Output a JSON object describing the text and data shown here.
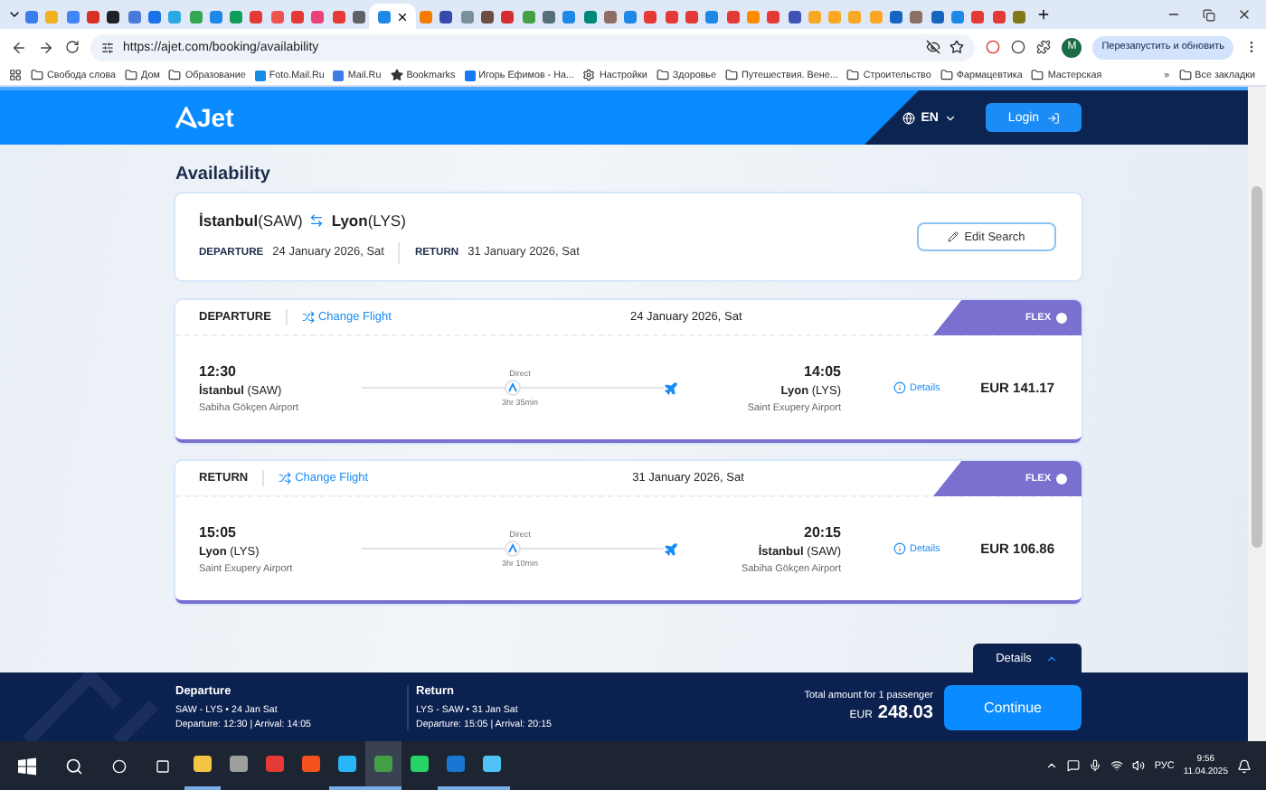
{
  "browser": {
    "tabs": [
      {
        "color": "#3b7ded",
        "selected": false
      },
      {
        "color": "#f2b01e",
        "selected": false
      },
      {
        "color": "#4285f4",
        "selected": false
      },
      {
        "color": "#d93025",
        "selected": false
      },
      {
        "color": "#202124",
        "selected": false
      },
      {
        "color": "#4a7bd8",
        "selected": false
      },
      {
        "color": "#1a73e8",
        "selected": false
      },
      {
        "color": "#29a9e1",
        "selected": false
      },
      {
        "color": "#34a853",
        "selected": false
      },
      {
        "color": "#1e88e5",
        "selected": false
      },
      {
        "color": "#0f9d58",
        "selected": false
      },
      {
        "color": "#e53935",
        "selected": false
      },
      {
        "color": "#ef5350",
        "selected": false
      },
      {
        "color": "#e53935",
        "selected": false
      },
      {
        "color": "#ec407a",
        "selected": false
      },
      {
        "color": "#e53935",
        "selected": false
      },
      {
        "color": "#5f6368",
        "selected": false
      },
      {
        "color": "#1e88e5",
        "selected": true
      },
      {
        "color": "#f57c00",
        "selected": false
      },
      {
        "color": "#3949ab",
        "selected": false
      },
      {
        "color": "#78909c",
        "selected": false
      },
      {
        "color": "#6d4c41",
        "selected": false
      },
      {
        "color": "#d32f2f",
        "selected": false
      },
      {
        "color": "#43a047",
        "selected": false
      },
      {
        "color": "#546e7a",
        "selected": false
      },
      {
        "color": "#1e88e5",
        "selected": false
      },
      {
        "color": "#00897b",
        "selected": false
      },
      {
        "color": "#8d6e63",
        "selected": false
      },
      {
        "color": "#1e88e5",
        "selected": false
      },
      {
        "color": "#e53935",
        "selected": false
      },
      {
        "color": "#e53935",
        "selected": false
      },
      {
        "color": "#e53935",
        "selected": false
      },
      {
        "color": "#1e88e5",
        "selected": false
      },
      {
        "color": "#e53935",
        "selected": false
      },
      {
        "color": "#fb8c00",
        "selected": false
      },
      {
        "color": "#e53935",
        "selected": false
      },
      {
        "color": "#3f51b5",
        "selected": false
      },
      {
        "color": "#f9a825",
        "selected": false
      },
      {
        "color": "#f9a825",
        "selected": false
      },
      {
        "color": "#f9a825",
        "selected": false
      },
      {
        "color": "#f9a825",
        "selected": false
      },
      {
        "color": "#1565c0",
        "selected": false
      },
      {
        "color": "#8d6e63",
        "selected": false
      },
      {
        "color": "#1565c0",
        "selected": false
      },
      {
        "color": "#1e88e5",
        "selected": false
      },
      {
        "color": "#e53935",
        "selected": false
      },
      {
        "color": "#e53935",
        "selected": false
      },
      {
        "color": "#827717",
        "selected": false
      }
    ],
    "url": "https://ajet.com/booking/availability",
    "profile_initial": "M",
    "restart_button": "Перезапустить и обновить",
    "bookmarks": [
      {
        "kind": "folder",
        "label": "Свобода слова"
      },
      {
        "kind": "folder",
        "label": "Дом"
      },
      {
        "kind": "folder",
        "label": "Образование"
      },
      {
        "kind": "site",
        "label": "Foto.Mail.Ru",
        "color": "#168de2"
      },
      {
        "kind": "site",
        "label": "Mail.Ru",
        "color": "#3d7de8"
      },
      {
        "kind": "star",
        "label": "Bookmarks"
      },
      {
        "kind": "site",
        "label": "Игорь Ефимов - На...",
        "color": "#1877f2"
      },
      {
        "kind": "gear",
        "label": "Настройки"
      },
      {
        "kind": "folder",
        "label": "Здоровье"
      },
      {
        "kind": "folder",
        "label": "Путешествия. Вене..."
      },
      {
        "kind": "folder",
        "label": "Строительство"
      },
      {
        "kind": "folder",
        "label": "Фармацевтика"
      },
      {
        "kind": "folder",
        "label": "Мастерская"
      }
    ],
    "more": "»",
    "all_bookmarks": "Все закладки"
  },
  "header": {
    "logo": "Jet",
    "language": "EN",
    "login": "Login"
  },
  "title": "Availability",
  "search": {
    "origin_city": "İstanbul",
    "origin_code": "(SAW)",
    "destination_city": "Lyon",
    "destination_code": "(LYS)",
    "departure_label": "DEPARTURE",
    "departure_date": "24 January 2026, Sat",
    "return_label": "RETURN",
    "return_date": "31 January 2026, Sat",
    "edit": "Edit Search"
  },
  "flights": [
    {
      "direction": "DEPARTURE",
      "change": "Change Flight",
      "date": "24 January 2026, Sat",
      "fare": {
        "label": "FLEX",
        "selected": true
      },
      "dep_time": "12:30",
      "dep_city": "İstanbul",
      "dep_code": "(SAW)",
      "dep_airport": "Sabiha Gökçen Airport",
      "stop": "Direct",
      "duration": "3hr 35min",
      "arr_time": "14:05",
      "arr_city": "Lyon",
      "arr_code": "(LYS)",
      "arr_airport": "Saint Exupery Airport",
      "details": "Details",
      "price": "EUR 141.17"
    },
    {
      "direction": "RETURN",
      "change": "Change Flight",
      "date": "31 January 2026, Sat",
      "fare": {
        "label": "FLEX",
        "selected": true
      },
      "dep_time": "15:05",
      "dep_city": "Lyon",
      "dep_code": "(LYS)",
      "dep_airport": "Saint Exupery Airport",
      "stop": "Direct",
      "duration": "3hr 10min",
      "arr_time": "20:15",
      "arr_city": "İstanbul",
      "arr_code": "(SAW)",
      "arr_airport": "Sabiha Gökçen Airport",
      "details": "Details",
      "price": "EUR 106.86"
    }
  ],
  "details_tab": "Details",
  "footer": {
    "legs": [
      {
        "title": "Departure",
        "route": "SAW - LYS • 24 Jan Sat",
        "times": "Departure: 12:30 | Arrival: 14:05"
      },
      {
        "title": "Return",
        "route": "LYS - SAW • 31 Jan Sat",
        "times": "Departure: 15:05 | Arrival: 20:15"
      }
    ],
    "total_label": "Total amount for 1 passenger",
    "currency": "EUR",
    "total": "248.03",
    "continue": "Continue"
  },
  "taskbar": {
    "apps": [
      {
        "color": "#f4c542",
        "running": true,
        "selected": false
      },
      {
        "color": "#9e9e9e",
        "running": false,
        "selected": false
      },
      {
        "color": "#e53935",
        "running": false,
        "selected": false
      },
      {
        "color": "#f4511e",
        "running": false,
        "selected": false
      },
      {
        "color": "#29b6f6",
        "running": true,
        "selected": false
      },
      {
        "color": "#43a047",
        "running": true,
        "selected": true
      },
      {
        "color": "#25d366",
        "running": false,
        "selected": false
      },
      {
        "color": "#1976d2",
        "running": true,
        "selected": false
      },
      {
        "color": "#4fc3f7",
        "running": true,
        "selected": false
      }
    ],
    "language": "РУС",
    "time": "9:56",
    "date": "11.04.2025"
  }
}
